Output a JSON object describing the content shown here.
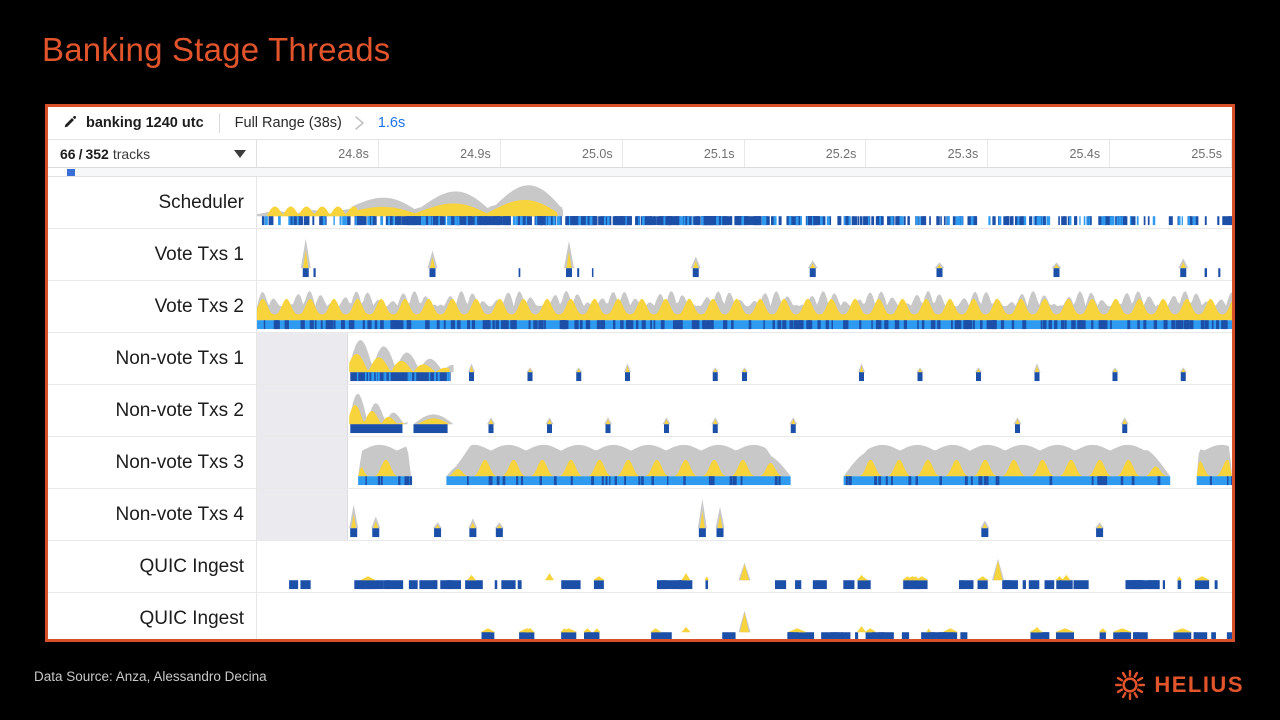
{
  "slide": {
    "title": "Banking Stage Threads",
    "data_source": "Data Source: Anza, Alessandro Decina",
    "background": "#000000",
    "accent_color": "#e2542c"
  },
  "toolbar": {
    "pencil_icon": "pencil-icon",
    "trace_name": "banking 1240 utc",
    "full_range_label": "Full Range (38s)",
    "chevron_icon": "chevron-right-icon",
    "current_range_label": "1.6s",
    "current_range_color": "#1a73e8"
  },
  "track_header": {
    "visible_tracks": "66",
    "separator": "/",
    "total_tracks": "352",
    "tracks_word": "tracks",
    "dropdown_icon": "caret-down-icon"
  },
  "ruler": {
    "ticks": [
      "24.8s",
      "24.9s",
      "25.0s",
      "25.1s",
      "25.2s",
      "25.3s",
      "25.4s",
      "25.5s"
    ]
  },
  "tracks": [
    {
      "label": "Scheduler",
      "has_nodata_region": false
    },
    {
      "label": "Vote Txs 1",
      "has_nodata_region": false
    },
    {
      "label": "Vote Txs 2",
      "has_nodata_region": false
    },
    {
      "label": "Non-vote Txs 1",
      "has_nodata_region": true
    },
    {
      "label": "Non-vote Txs 2",
      "has_nodata_region": true
    },
    {
      "label": "Non-vote Txs 3",
      "has_nodata_region": true
    },
    {
      "label": "Non-vote Txs 4",
      "has_nodata_region": true
    },
    {
      "label": "QUIC Ingest",
      "has_nodata_region": false
    },
    {
      "label": "QUIC Ingest",
      "has_nodata_region": false
    }
  ],
  "logo": {
    "mark_icon": "helius-sun-icon",
    "wordmark": "HELIUS",
    "color": "#e2542c"
  },
  "chart_data": {
    "type": "area",
    "title": "Banking Stage Threads",
    "xlabel": "",
    "ylabel": "",
    "x_axis_unit": "seconds",
    "x_tick_labels": [
      "24.8s",
      "24.9s",
      "25.0s",
      "25.1s",
      "25.2s",
      "25.3s",
      "25.4s",
      "25.5s"
    ],
    "xlim": [
      24.75,
      25.55
    ],
    "grid": false,
    "legend": "none",
    "series_colors": {
      "cpu_grey": "#c8c8c8",
      "peak_yellow": "#f7d33c",
      "slice_dark_blue": "#1c4fa8",
      "slice_light_blue": "#2f9bf0"
    },
    "series": [
      {
        "name": "Scheduler",
        "area_grey": [
          0,
          0,
          0,
          0,
          2,
          3,
          2,
          4,
          6,
          5,
          3,
          4,
          10,
          7,
          4,
          3,
          8,
          6,
          3,
          2,
          18,
          26,
          30,
          27,
          33,
          30,
          24,
          32,
          26,
          30,
          22,
          34,
          28,
          24,
          32,
          27,
          31,
          25,
          33,
          29,
          24,
          30,
          28,
          22,
          26,
          18,
          8,
          2,
          0,
          0,
          0,
          0,
          0,
          0,
          0,
          0,
          0,
          0,
          0,
          0,
          0,
          0,
          0,
          0,
          0,
          0,
          0,
          0,
          0,
          0,
          0,
          0,
          0,
          0,
          0,
          0,
          0,
          0,
          0,
          0
        ],
        "peaks_yellow": [
          0,
          0,
          0,
          0,
          1,
          2,
          1,
          3,
          4,
          3,
          2,
          3,
          7,
          5,
          2,
          2,
          6,
          4,
          2,
          1,
          14,
          20,
          10,
          8,
          12,
          9,
          6,
          11,
          7,
          9,
          5,
          12,
          8,
          6,
          10,
          7,
          9,
          6,
          12,
          9,
          6,
          10,
          8,
          5,
          8,
          6,
          3,
          1,
          0,
          0,
          0,
          0,
          0,
          0,
          0,
          0,
          0,
          0,
          0,
          0,
          0,
          0,
          0,
          0,
          0,
          0,
          0,
          0,
          0,
          0,
          0,
          0,
          0,
          0,
          0,
          0,
          0,
          0,
          0,
          0
        ],
        "slice_density": "dense across full width, heaviest 24.85s-25.0s"
      },
      {
        "name": "Vote Txs 1",
        "spikes_at": [
          0.05,
          0.18,
          0.32,
          0.45,
          0.57,
          0.7,
          0.82,
          0.95
        ],
        "spike_heights": [
          30,
          18,
          28,
          12,
          8,
          6,
          6,
          10
        ],
        "slice_density": "sparse isolated marks"
      },
      {
        "name": "Vote Txs 2",
        "area_grey": [
          26,
          30,
          24,
          28,
          22,
          30,
          26,
          32,
          24,
          28,
          30,
          22,
          26,
          30,
          24,
          28,
          26,
          30,
          24,
          32,
          26,
          28,
          24,
          30,
          26,
          22,
          28,
          30,
          24,
          26,
          30,
          28,
          22,
          26,
          30,
          24,
          28,
          26,
          22,
          30,
          26,
          28,
          24,
          30,
          26,
          22,
          28,
          24,
          30,
          26,
          28,
          22,
          26,
          30,
          24,
          28,
          26,
          30,
          22,
          26,
          28,
          24,
          30,
          26,
          22,
          28,
          30,
          24,
          26,
          30,
          28,
          22,
          26,
          24,
          28,
          30,
          26,
          22,
          28,
          26
        ],
        "peaks_yellow": [
          16,
          20,
          12,
          18,
          10,
          20,
          14,
          22,
          12,
          16,
          20,
          10,
          14,
          20,
          12,
          18,
          14,
          20,
          12,
          22,
          14,
          16,
          10,
          20,
          14,
          8,
          18,
          20,
          12,
          14,
          20,
          18,
          8,
          14,
          20,
          10,
          18,
          14,
          8,
          20,
          14,
          18,
          10,
          20,
          14,
          8,
          18,
          10,
          20,
          14,
          18,
          8,
          14,
          20,
          10,
          18,
          14,
          20,
          8,
          14,
          18,
          10,
          20,
          14,
          8,
          18,
          20,
          10,
          14,
          20,
          18,
          8,
          14,
          10,
          18,
          20,
          14,
          8,
          18,
          14
        ],
        "slice_density": "continuous solid blue bar full width"
      },
      {
        "name": "Non-vote Txs 1",
        "nodata_until": 24.83,
        "burst_grey": [
          20,
          30,
          26,
          34,
          28,
          32,
          30,
          24,
          22,
          18,
          14,
          10,
          6,
          3,
          0
        ],
        "burst_yellow": [
          12,
          20,
          16,
          22,
          18,
          20,
          18,
          14,
          12,
          10,
          8,
          5,
          3,
          1,
          0
        ],
        "spikes_after": [
          0.22,
          0.28,
          0.33,
          0.38,
          0.47,
          0.5,
          0.62,
          0.68,
          0.74
        ],
        "slice_density": "dense at burst, sparse isolated marks after"
      },
      {
        "name": "Non-vote Txs 2",
        "nodata_until": 24.83,
        "burst_grey": [
          22,
          34,
          28,
          20,
          16,
          12,
          8,
          4,
          0
        ],
        "burst_yellow": [
          14,
          24,
          18,
          12,
          10,
          7,
          4,
          2,
          0
        ],
        "spikes_after": [
          0.12,
          0.22,
          0.27,
          0.32,
          0.37,
          0.42,
          0.52,
          0.78
        ],
        "slice_density": "moderate at burst then sparse"
      },
      {
        "name": "Non-vote Txs 3",
        "nodata_until": 24.83,
        "plateau_ranges": [
          [
            0.01,
            0.07
          ],
          [
            0.11,
            0.5
          ],
          [
            0.56,
            0.93
          ],
          [
            0.96,
            1.0
          ]
        ],
        "plateau_height": 32,
        "peaks_yellow": 14,
        "slice_density": "continuous light blue under plateaus"
      },
      {
        "name": "Non-vote Txs 4",
        "nodata_until": 24.83,
        "spikes_at": [
          0.005,
          0.03,
          0.1,
          0.14,
          0.17,
          0.4,
          0.42,
          0.72,
          0.85
        ],
        "spike_heights": [
          24,
          12,
          6,
          10,
          6,
          30,
          22,
          8,
          6
        ],
        "slice_density": "very sparse"
      },
      {
        "name": "QUIC Ingest",
        "bar_density": "sparse dark blue bars across full width",
        "peaks_yellow": [
          0.22,
          0.3,
          0.44,
          0.5,
          0.62,
          0.76,
          0.83
        ],
        "peak_heights": [
          6,
          8,
          8,
          18,
          6,
          22,
          6
        ]
      },
      {
        "name": "QUIC Ingest",
        "bar_density": "sparse dark blue bars, heavier right half",
        "peaks_yellow": [
          0.28,
          0.44,
          0.5,
          0.62,
          0.8
        ],
        "peak_heights": [
          5,
          6,
          22,
          7,
          6
        ]
      }
    ]
  }
}
